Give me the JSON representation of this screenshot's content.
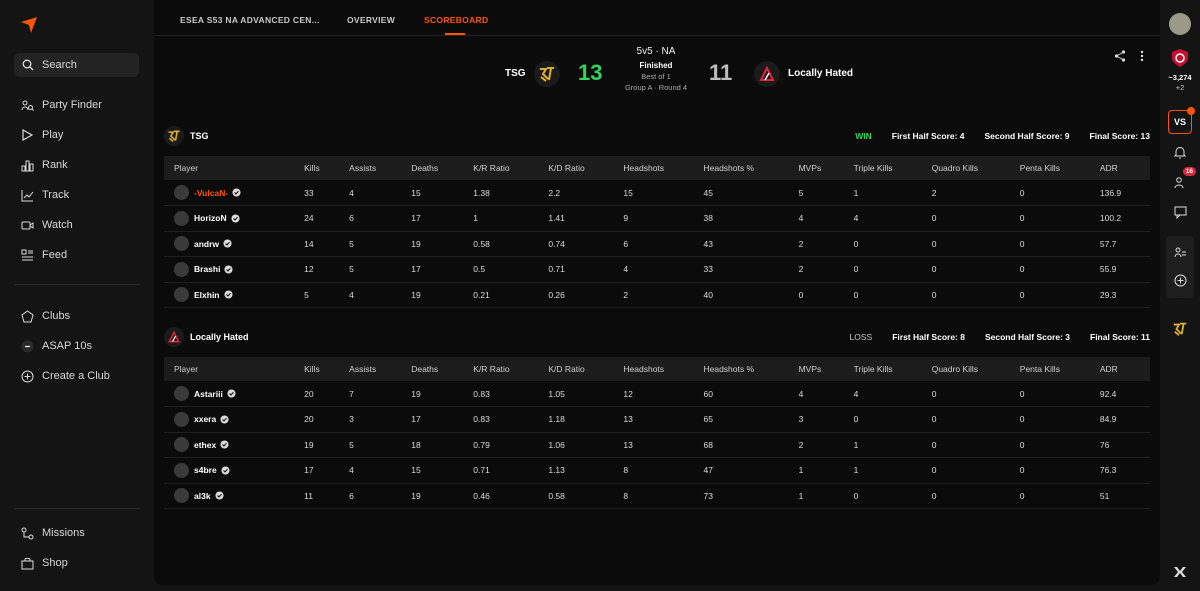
{
  "sidebar": {
    "search_label": "Search",
    "nav": [
      {
        "label": "Party Finder",
        "icon": "party-finder-icon"
      },
      {
        "label": "Play",
        "icon": "play-icon"
      },
      {
        "label": "Rank",
        "icon": "rank-icon"
      },
      {
        "label": "Track",
        "icon": "track-icon"
      },
      {
        "label": "Watch",
        "icon": "watch-icon"
      },
      {
        "label": "Feed",
        "icon": "feed-icon"
      }
    ],
    "clubs": [
      {
        "label": "Clubs",
        "icon": "clubs-icon"
      },
      {
        "label": "ASAP 10s",
        "icon": "club-avatar"
      },
      {
        "label": "Create a Club",
        "icon": "plus-circle-icon"
      }
    ],
    "bottom": [
      {
        "label": "Missions",
        "icon": "missions-icon"
      },
      {
        "label": "Shop",
        "icon": "shop-icon"
      }
    ]
  },
  "tabs": [
    {
      "label": "ESEA S53 NA ADVANCED CEN..."
    },
    {
      "label": "OVERVIEW"
    },
    {
      "label": "SCOREBOARD"
    }
  ],
  "match": {
    "format": "5v5 · NA",
    "status": "Finished",
    "best_of": "Best of 1",
    "group": "Group A · Round 4",
    "team1": {
      "name": "TSG",
      "score": "13",
      "score_color": "#32d35a"
    },
    "team2": {
      "name": "Locally Hated",
      "score": "11",
      "score_color": "#bdbdbd"
    }
  },
  "columns": [
    "Player",
    "Kills",
    "Assists",
    "Deaths",
    "K/R Ratio",
    "K/D Ratio",
    "Headshots",
    "Headshots %",
    "MVPs",
    "Triple Kills",
    "Quadro Kills",
    "Penta Kills",
    "ADR"
  ],
  "team1_section": {
    "name": "TSG",
    "result": "WIN",
    "first_half": "First Half Score: 4",
    "second_half": "Second Half Score: 9",
    "final": "Final Score: 13",
    "players": [
      {
        "name": "-VulcaN-",
        "highlight": true,
        "stats": [
          "33",
          "4",
          "15",
          "1.38",
          "2.2",
          "15",
          "45",
          "5",
          "1",
          "2",
          "0",
          "136.9"
        ]
      },
      {
        "name": "HorizoN",
        "stats": [
          "24",
          "6",
          "17",
          "1",
          "1.41",
          "9",
          "38",
          "4",
          "4",
          "0",
          "0",
          "100.2"
        ]
      },
      {
        "name": "andrw",
        "stats": [
          "14",
          "5",
          "19",
          "0.58",
          "0.74",
          "6",
          "43",
          "2",
          "0",
          "0",
          "0",
          "57.7"
        ]
      },
      {
        "name": "Brashi",
        "stats": [
          "12",
          "5",
          "17",
          "0.5",
          "0.71",
          "4",
          "33",
          "2",
          "0",
          "0",
          "0",
          "55.9"
        ]
      },
      {
        "name": "Elxhin",
        "stats": [
          "5",
          "4",
          "19",
          "0.21",
          "0.26",
          "2",
          "40",
          "0",
          "0",
          "0",
          "0",
          "29.3"
        ]
      }
    ]
  },
  "team2_section": {
    "name": "Locally Hated",
    "result": "LOSS",
    "first_half": "First Half Score: 8",
    "second_half": "Second Half Score: 3",
    "final": "Final Score: 11",
    "players": [
      {
        "name": "Astariii",
        "stats": [
          "20",
          "7",
          "19",
          "0.83",
          "1.05",
          "12",
          "60",
          "4",
          "4",
          "0",
          "0",
          "92.4"
        ]
      },
      {
        "name": "xxera",
        "stats": [
          "20",
          "3",
          "17",
          "0.83",
          "1.18",
          "13",
          "65",
          "3",
          "0",
          "0",
          "0",
          "84.9"
        ]
      },
      {
        "name": "ethex",
        "stats": [
          "19",
          "5",
          "18",
          "0.79",
          "1.06",
          "13",
          "68",
          "2",
          "1",
          "0",
          "0",
          "76"
        ]
      },
      {
        "name": "s4bre",
        "stats": [
          "17",
          "4",
          "15",
          "0.71",
          "1.13",
          "8",
          "47",
          "1",
          "1",
          "0",
          "0",
          "76.3"
        ]
      },
      {
        "name": "al3k",
        "stats": [
          "11",
          "6",
          "19",
          "0.46",
          "0.58",
          "8",
          "73",
          "1",
          "0",
          "0",
          "0",
          "51"
        ]
      }
    ]
  },
  "rail": {
    "points": "~3,274",
    "points_delta": "+2",
    "vs_label": "VS",
    "friends_badge": "16"
  },
  "colors": {
    "accent": "#ff5500",
    "win": "#32d35a"
  }
}
